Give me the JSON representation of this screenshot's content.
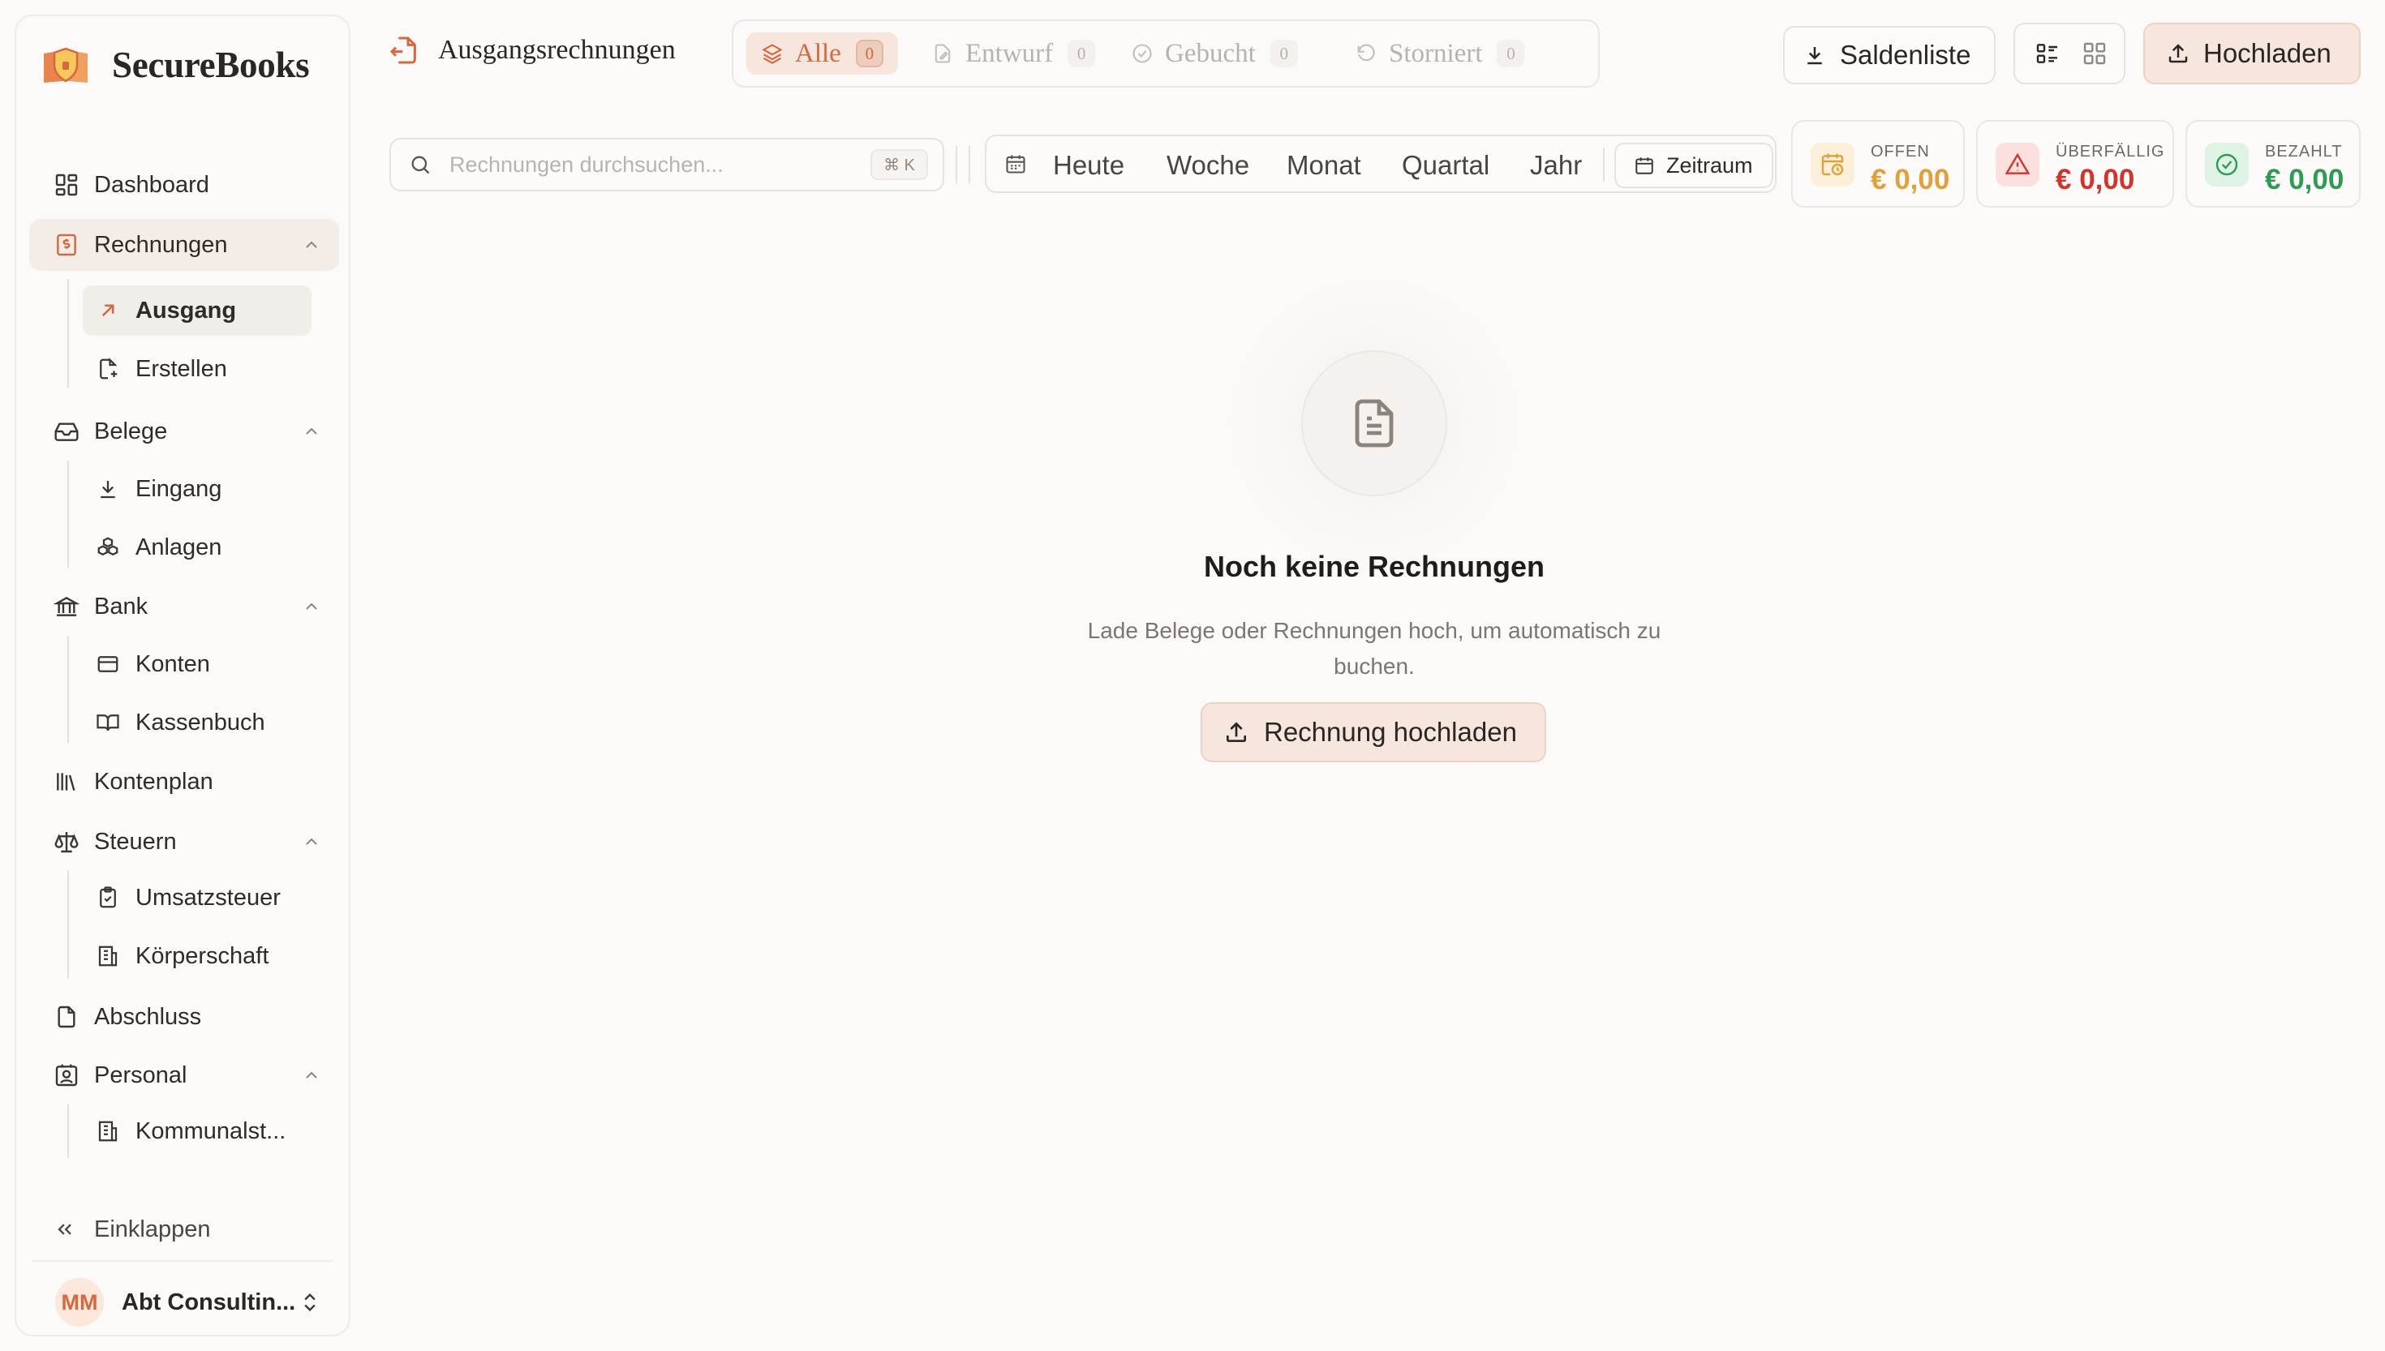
{
  "app": {
    "name": "SecureBooks"
  },
  "sidebar": {
    "items": {
      "dashboard": "Dashboard",
      "rechnungen": "Rechnungen",
      "ausgang": "Ausgang",
      "erstellen": "Erstellen",
      "belege": "Belege",
      "eingang": "Eingang",
      "anlagen": "Anlagen",
      "bank": "Bank",
      "konten": "Konten",
      "kassenbuch": "Kassenbuch",
      "kontenplan": "Kontenplan",
      "steuern": "Steuern",
      "umsatzsteuer": "Umsatzsteuer",
      "koerperschaft": "Körperschaft",
      "abschluss": "Abschluss",
      "personal": "Personal",
      "kommunal": "Kommunalst..."
    },
    "collapse_label": "Einklappen",
    "account": {
      "initials": "MM",
      "name": "Abt Consultin..."
    }
  },
  "header": {
    "title": "Ausgangsrechnungen",
    "status_tabs": [
      {
        "label": "Alle",
        "count": "0"
      },
      {
        "label": "Entwurf",
        "count": "0"
      },
      {
        "label": "Gebucht",
        "count": "0"
      },
      {
        "label": "Storniert",
        "count": "0"
      }
    ],
    "saldenliste_label": "Saldenliste",
    "upload_label": "Hochladen"
  },
  "filters": {
    "search_placeholder": "Rechnungen durchsuchen...",
    "search_shortcut": "⌘ K",
    "periods": [
      "Heute",
      "Woche",
      "Monat",
      "Quartal",
      "Jahr"
    ],
    "zeitraum_label": "Zeitraum"
  },
  "kpis": [
    {
      "label": "OFFEN",
      "value": "€ 0,00",
      "color": "#e0a13a",
      "bg": "#fbefd9"
    },
    {
      "label": "ÜBERFÄLLIG",
      "value": "€ 0,00",
      "color": "#d0342c",
      "bg": "#fbe0de"
    },
    {
      "label": "BEZAHLT",
      "value": "€ 0,00",
      "color": "#2f9a55",
      "bg": "#def3e4"
    }
  ],
  "empty_state": {
    "title": "Noch keine Rechnungen",
    "text": "Lade Belege oder Rechnungen hoch, um automatisch zu buchen.",
    "button_label": "Rechnung hochladen"
  },
  "colors": {
    "accent": "#d4683f",
    "accent_bg": "#f6e6dd"
  }
}
